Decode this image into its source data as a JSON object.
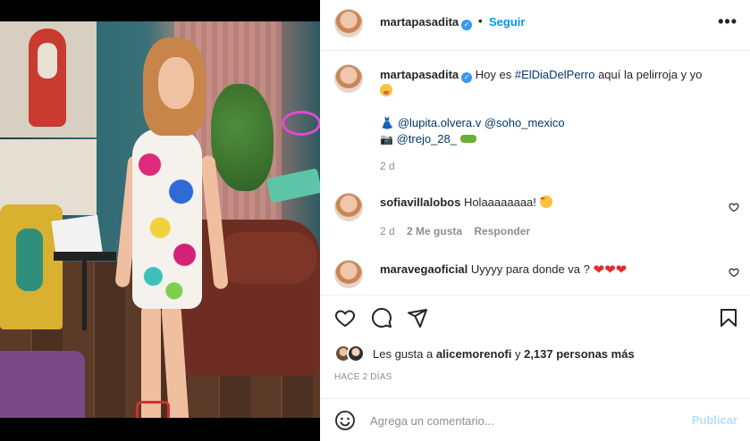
{
  "post": {
    "author": "martapasadita",
    "follow_label": "Seguir",
    "dot": "•",
    "more_label": "•••"
  },
  "caption": {
    "author": "martapasadita",
    "text_before": "Hoy es ",
    "hashtag": "#ElDiaDelPerro",
    "text_after": " aquí la pelirroja y yo",
    "line2_handle1": "@lupita.olvera.v",
    "line2_handle2": "@soho_mexico",
    "line3_handle": "@trejo_28_",
    "time": "2 d"
  },
  "comments": [
    {
      "author": "sofiavillalobos",
      "text": "Holaaaaaaaa!",
      "time": "2 d",
      "likes": "2 Me gusta",
      "reply": "Responder"
    },
    {
      "author": "maravegaoficial",
      "text": "Uyyyy para donde va ?"
    }
  ],
  "likes": {
    "prefix": "Les gusta a ",
    "user": "alicemorenofi",
    "connector": " y ",
    "count": "2,137 personas más"
  },
  "time_ago": "HACE 2 DÍAS",
  "comment_box": {
    "placeholder": "Agrega un comentario...",
    "publish_label": "Publicar"
  },
  "icons": {
    "like": "heart-icon",
    "comment": "comment-icon",
    "share": "share-icon",
    "save": "bookmark-icon",
    "emoji": "smiley-icon"
  },
  "colors": {
    "accent": "#0095f6",
    "verified": "#3897f0",
    "publish_disabled": "#b2dffc"
  }
}
